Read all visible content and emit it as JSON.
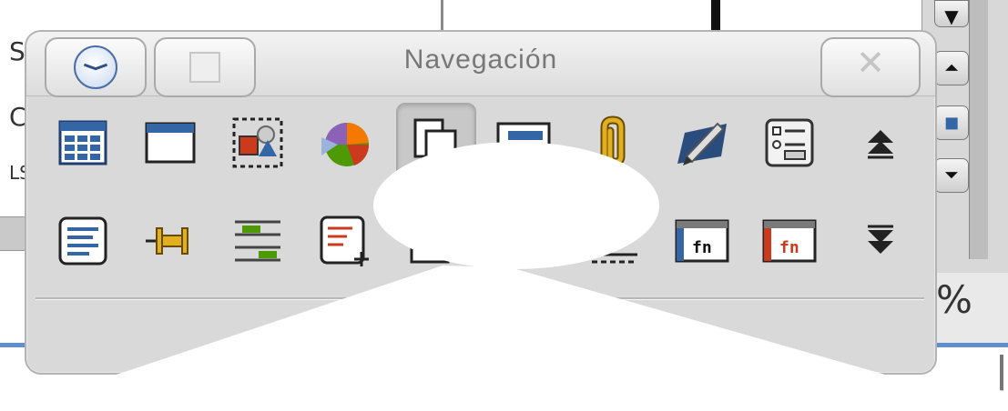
{
  "background": {
    "left_chars": [
      "S",
      "C",
      "LS"
    ],
    "top_char": "1",
    "percent_label": "%",
    "scroll_buttons": [
      "▼",
      "⏶",
      "◼",
      "⏷"
    ]
  },
  "navigator": {
    "title": "Navegación",
    "menu_icon": "clock-icon",
    "shade_icon": "square-icon",
    "close_label": "✕",
    "row1": [
      {
        "icon": "table-icon"
      },
      {
        "icon": "frame-icon"
      },
      {
        "icon": "images-icon"
      },
      {
        "icon": "ole-objects-icon"
      },
      {
        "icon": "bookmarks-icon",
        "active": true
      },
      {
        "icon": "sections-icon"
      },
      {
        "icon": "hyperlinks-icon"
      },
      {
        "icon": "drawing-objects-icon"
      },
      {
        "icon": "fields-icon"
      },
      {
        "icon": "previous-icon"
      }
    ],
    "row2": [
      {
        "icon": "paragraph-icon"
      },
      {
        "icon": "anchor-icon"
      },
      {
        "icon": "references-icon"
      },
      {
        "icon": "comments-icon"
      },
      {
        "icon": "hidden-icon"
      },
      {
        "icon": "indexes-icon"
      },
      {
        "icon": "hidden-icon-2"
      },
      {
        "icon": "formula-icon"
      },
      {
        "icon": "wrong-formula-icon"
      },
      {
        "icon": "next-icon"
      }
    ],
    "formula_label": "fn"
  },
  "colors": {
    "accent_blue": "#5f8fce",
    "window_bg": "#d9d9d9",
    "icon_blue": "#3465a4",
    "icon_green": "#4e9a06",
    "icon_red": "#cc3a1e"
  }
}
